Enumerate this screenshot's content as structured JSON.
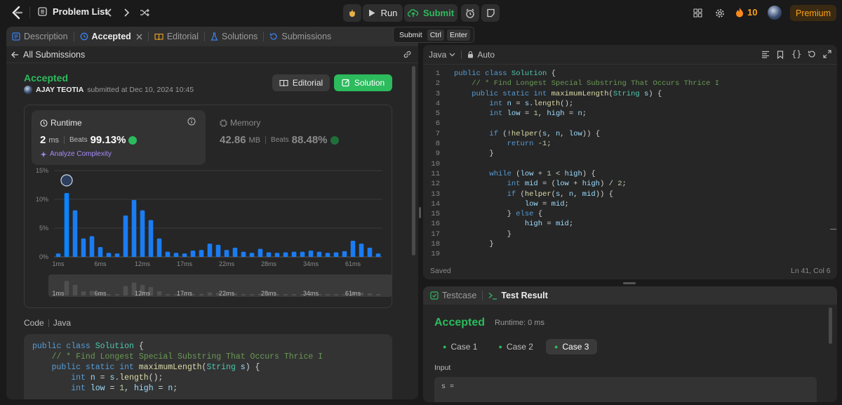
{
  "topbar": {
    "problem_list": "Problem List",
    "run": "Run",
    "submit": "Submit",
    "streak": "10",
    "premium": "Premium",
    "tooltip": {
      "label": "Submit",
      "key1": "Ctrl",
      "key2": "Enter"
    }
  },
  "left_tabs": {
    "description": "Description",
    "accepted": "Accepted",
    "editorial": "Editorial",
    "solutions": "Solutions",
    "submissions": "Submissions"
  },
  "submission": {
    "back": "All Submissions",
    "status": "Accepted",
    "user": "AJAY TEOTIA",
    "submitted": "submitted at Dec 10, 2024 10:45",
    "editorial_btn": "Editorial",
    "solution_btn": "Solution",
    "runtime": {
      "label": "Runtime",
      "value": "2",
      "unit": "ms",
      "beats_label": "Beats",
      "beats": "99.13%",
      "analyze": "Analyze Complexity"
    },
    "memory": {
      "label": "Memory",
      "value": "42.86",
      "unit": "MB",
      "beats_label": "Beats",
      "beats": "88.48%"
    },
    "code_label": "Code",
    "code_lang": "Java"
  },
  "chart_data": {
    "type": "bar",
    "ylabel_ticks": [
      "15%",
      "10%",
      "5%",
      "0%"
    ],
    "ylim": [
      0,
      15
    ],
    "x_tick_labels": [
      "1ms",
      "6ms",
      "12ms",
      "17ms",
      "22ms",
      "28ms",
      "34ms",
      "61ms"
    ],
    "values": [
      0.6,
      11.1,
      8.1,
      3.2,
      3.6,
      1.7,
      0.7,
      0.6,
      7.2,
      9.9,
      8.1,
      6.4,
      3.2,
      0.9,
      0.7,
      0.6,
      1.1,
      1.2,
      2.3,
      2.1,
      1.2,
      1.6,
      0.9,
      0.7,
      1.4,
      0.8,
      0.7,
      0.8,
      0.9,
      0.9,
      1.1,
      0.9,
      0.7,
      0.8,
      1.0,
      2.8,
      2.3,
      1.6,
      0.6
    ],
    "highlight_index": 1
  },
  "editor": {
    "language": "Java",
    "mode": "Auto",
    "status": "Saved",
    "cursor": "Ln 41, Col 6",
    "line_numbers": [
      "1",
      "2",
      "3",
      "4",
      "5",
      "6",
      "7",
      "8",
      "9",
      "10",
      "11",
      "12",
      "13",
      "14",
      "15",
      "16",
      "17",
      "18",
      "19"
    ]
  },
  "testpanel": {
    "testcase_tab": "Testcase",
    "result_tab": "Test Result",
    "status": "Accepted",
    "runtime": "Runtime: 0 ms",
    "cases": [
      "Case 1",
      "Case 2",
      "Case 3"
    ],
    "input_label": "Input",
    "param": "s ="
  },
  "colors": {
    "accent_green": "#2cbb5d",
    "bar_blue": "#0a84ff",
    "orange": "#ffa116"
  }
}
